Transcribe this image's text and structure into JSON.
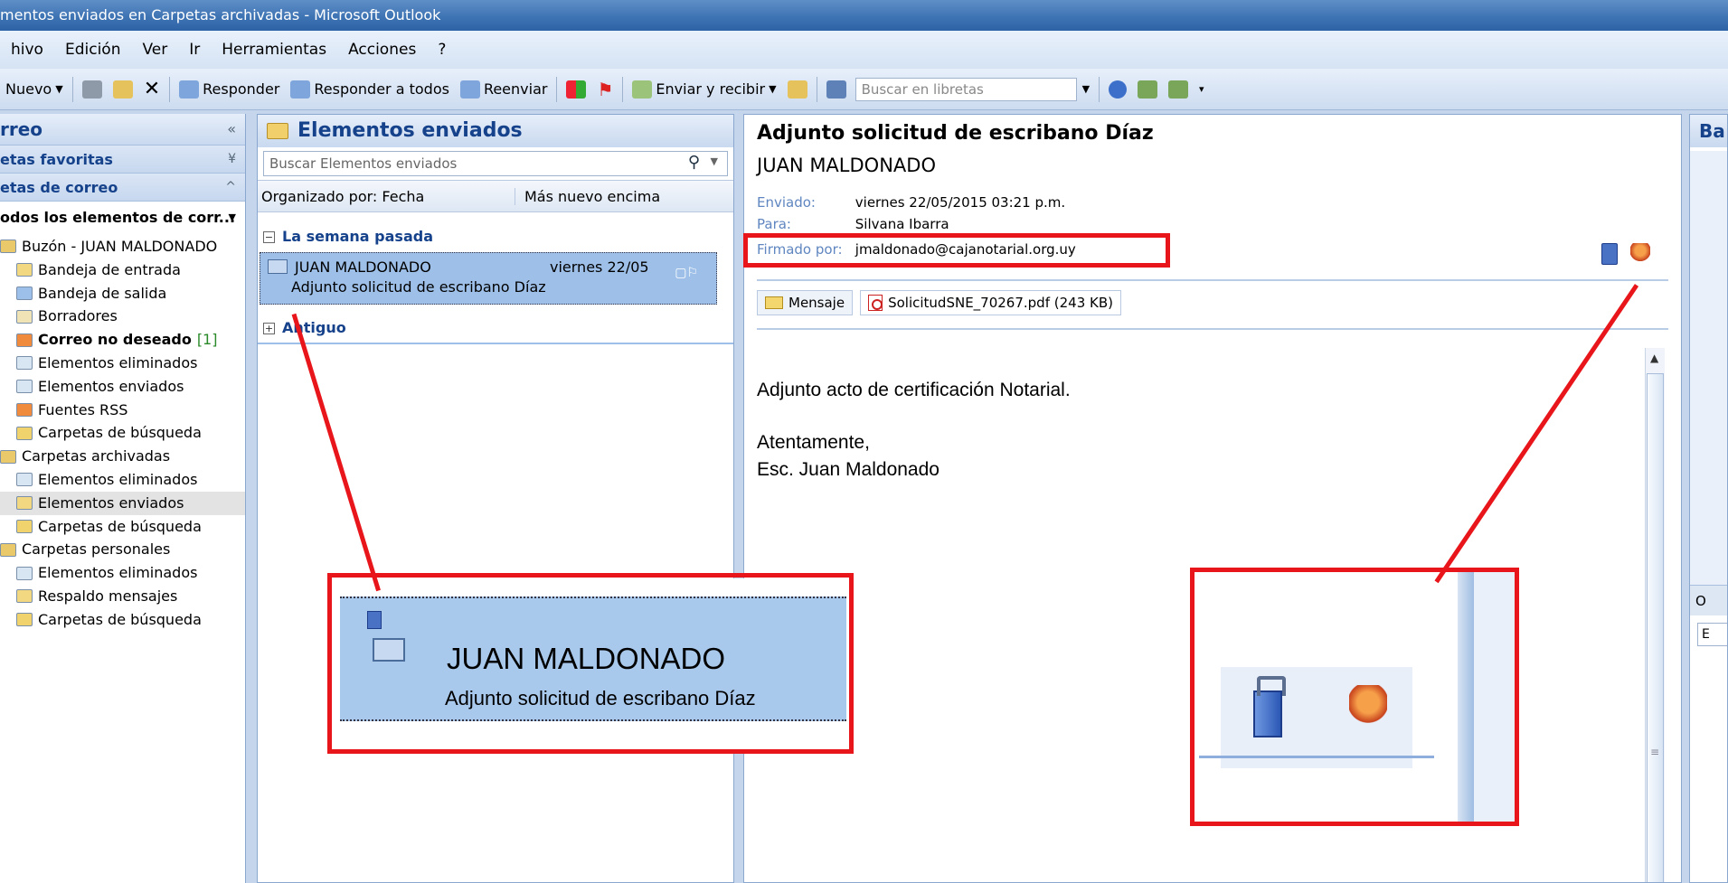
{
  "window": {
    "title": "mentos enviados en Carpetas archivadas - Microsoft Outlook"
  },
  "menu": [
    {
      "label": "hivo"
    },
    {
      "label": "Edición"
    },
    {
      "label": "Ver"
    },
    {
      "label": "Ir"
    },
    {
      "label": "Herramientas"
    },
    {
      "label": "Acciones"
    },
    {
      "label": "?"
    }
  ],
  "toolbar": {
    "new_label": "Nuevo",
    "reply_label": "Responder",
    "reply_all_label": "Responder a todos",
    "forward_label": "Reenviar",
    "send_receive_label": "Enviar y recibir",
    "address_search_placeholder": "Buscar en libretas"
  },
  "nav": {
    "header": "rreo",
    "favorites": "etas favoritas",
    "mail_folders": "etas de correo",
    "all_items": "odos los elementos de corr...",
    "tree": [
      {
        "label": "Buzón - JUAN MALDONADO",
        "level": 0
      },
      {
        "label": "Bandeja de entrada",
        "level": 1
      },
      {
        "label": "Bandeja de salida",
        "level": 1
      },
      {
        "label": "Borradores",
        "level": 1
      },
      {
        "label": "Correo no deseado",
        "level": 1,
        "bold": true,
        "count": "[1]"
      },
      {
        "label": "Elementos eliminados",
        "level": 1
      },
      {
        "label": "Elementos enviados",
        "level": 1
      },
      {
        "label": "Fuentes RSS",
        "level": 1
      },
      {
        "label": "Carpetas de búsqueda",
        "level": 1
      },
      {
        "label": "Carpetas archivadas",
        "level": 0
      },
      {
        "label": "Elementos eliminados",
        "level": 1
      },
      {
        "label": "Elementos enviados",
        "level": 1,
        "selected": true
      },
      {
        "label": "Carpetas de búsqueda",
        "level": 1
      },
      {
        "label": "Carpetas personales",
        "level": 0
      },
      {
        "label": "Elementos eliminados",
        "level": 1
      },
      {
        "label": "Respaldo mensajes",
        "level": 1
      },
      {
        "label": "Carpetas de búsqueda",
        "level": 1
      }
    ]
  },
  "list": {
    "title": "Elementos enviados",
    "search_placeholder": "Buscar Elementos enviados",
    "arranged_by": "Organizado por: Fecha",
    "order": "Más nuevo encima",
    "group_last_week": "La semana pasada",
    "group_older": "Antiguo",
    "item": {
      "from": "JUAN MALDONADO",
      "date": "viernes 22/05",
      "subject": "Adjunto solicitud de escribano Díaz"
    }
  },
  "reading": {
    "subject": "Adjunto solicitud de escribano Díaz",
    "from": "JUAN MALDONADO",
    "sent_label": "Enviado:",
    "sent_value": "viernes 22/05/2015 03:21 p.m.",
    "to_label": "Para:",
    "to_value": "Silvana Ibarra",
    "signed_label": "Firmado por:",
    "signed_value": "jmaldonado@cajanotarial.org.uy",
    "tab_message": "Mensaje",
    "attachment": "SolicitudSNE_70267.pdf (243 KB)",
    "body": [
      "Adjunto acto de certificación Notarial.",
      "Atentamente,",
      "Esc. Juan Maldonado"
    ]
  },
  "todo": {
    "header": "Ba",
    "mid_label": "O",
    "box_label": "E"
  },
  "zoom_list": {
    "from": "JUAN MALDONADO",
    "subject": "Adjunto solicitud de escribano Díaz"
  },
  "colors": {
    "callout": "#e8161b",
    "selection": "#9ec0e8",
    "header_text": "#15428b"
  }
}
